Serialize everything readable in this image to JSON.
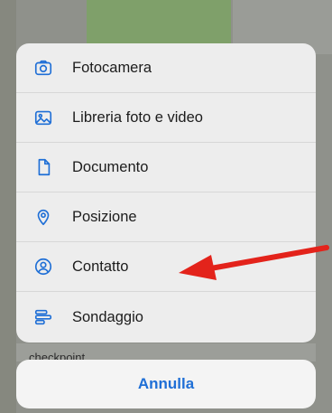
{
  "background": {
    "partial_text": "checkpoint"
  },
  "sheet": {
    "items": [
      {
        "icon": "camera-icon",
        "label": "Fotocamera"
      },
      {
        "icon": "photo-library-icon",
        "label": "Libreria foto e video"
      },
      {
        "icon": "document-icon",
        "label": "Documento"
      },
      {
        "icon": "location-pin-icon",
        "label": "Posizione"
      },
      {
        "icon": "contact-icon",
        "label": "Contatto"
      },
      {
        "icon": "poll-icon",
        "label": "Sondaggio"
      }
    ]
  },
  "cancel": {
    "label": "Annulla"
  },
  "colors": {
    "accent": "#1f6fd6",
    "arrow": "#e3231b",
    "sheet_bg": "#ededed"
  }
}
